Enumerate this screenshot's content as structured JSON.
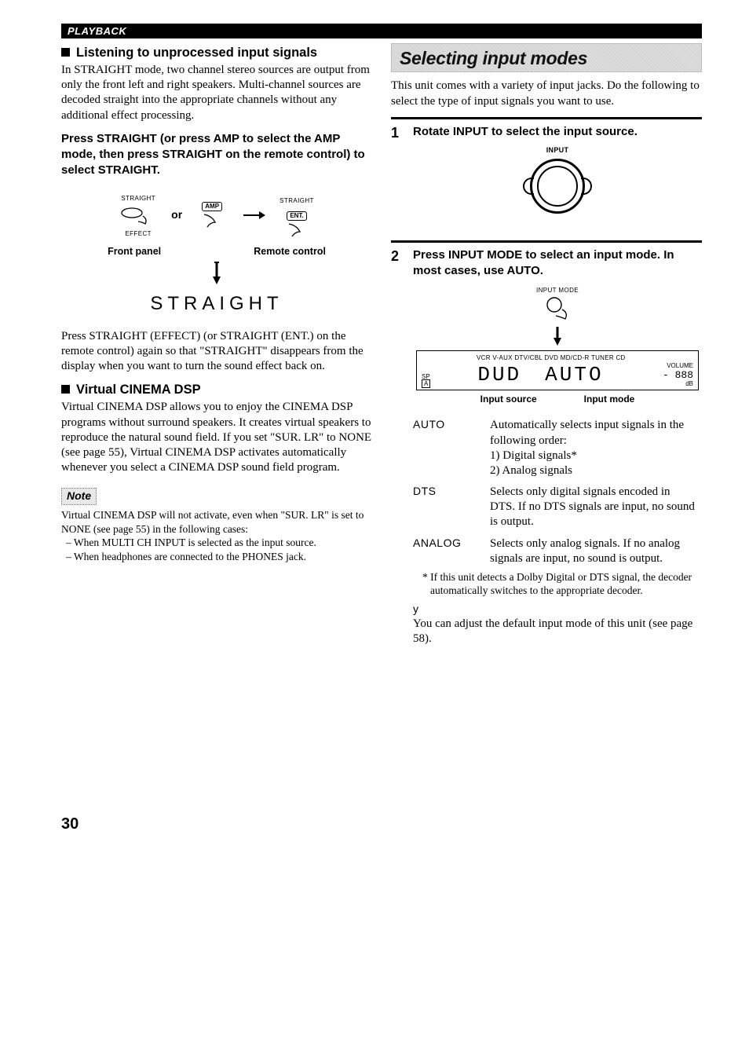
{
  "header": {
    "strip": "PLAYBACK"
  },
  "left": {
    "h1": "Listening to unprocessed input signals",
    "p1": "In STRAIGHT mode, two channel stereo sources are output from only the front left and right speakers. Multi-channel sources are decoded straight into the appropriate channels without any additional effect processing.",
    "instr": "Press STRAIGHT (or press AMP to select the AMP mode, then press STRAIGHT on the remote control) to select STRAIGHT.",
    "diag": {
      "straight_btn": "STRAIGHT",
      "effect_btn": "EFFECT",
      "or": "or",
      "amp_btn": "AMP",
      "ent_btn": "STRAIGHT",
      "ent_sub": "ENT.",
      "front_panel": "Front panel",
      "remote": "Remote control"
    },
    "straight_display": "STRAIGHT",
    "p2": "Press STRAIGHT (EFFECT) (or STRAIGHT (ENT.) on the remote control) again so that \"STRAIGHT\" disappears from the display when you want to turn the sound effect back on.",
    "h2": "Virtual CINEMA DSP",
    "p3": "Virtual CINEMA DSP allows you to enjoy the CINEMA DSP programs without surround speakers. It creates virtual speakers to reproduce the natural sound field. If you set \"SUR. LR\" to NONE (see page 55), Virtual CINEMA DSP activates automatically whenever you select a CINEMA DSP sound field program.",
    "note_label": "Note",
    "note1": "Virtual CINEMA DSP will not activate, even when \"SUR. LR\" is set to NONE (see page 55) in the following cases:",
    "note_b1": "– When MULTI CH INPUT is selected as the input source.",
    "note_b2": "– When headphones are connected to the PHONES jack."
  },
  "right": {
    "banner": "Selecting input modes",
    "intro": "This unit comes with a variety of input jacks. Do the following to select the type of input signals you want to use.",
    "step1": "Rotate INPUT to select the input source.",
    "input_label": "INPUT",
    "step2": "Press INPUT MODE to select an input mode. In most cases, use AUTO.",
    "inputmode_label": "INPUT MODE",
    "display": {
      "sources": "VCR    V-AUX    DTV/CBL    DVD    MD/CD-R    TUNER    CD",
      "sp": "SP",
      "a": "A",
      "dvd": "DUD",
      "auto": "AUTO",
      "volume": "VOLUME",
      "db": "dB"
    },
    "disp_lbl_src": "Input source",
    "disp_lbl_mode": "Input mode",
    "modes": {
      "auto_lbl": "AUTO",
      "auto_txt": "Automatically selects input signals in the following order:",
      "auto_1": "1) Digital signals*",
      "auto_2": "2) Analog signals",
      "dts_lbl": "DTS",
      "dts_txt": "Selects only digital signals encoded in DTS. If no DTS signals are input, no sound is output.",
      "analog_lbl": "ANALOG",
      "analog_txt": "Selects only analog signals. If no analog signals are input, no sound is output."
    },
    "asterisk": "*  If this unit detects a Dolby Digital or DTS signal, the decoder automatically switches to the appropriate decoder.",
    "tip_sym": "y",
    "tip": "You can adjust the default input mode of this unit (see page 58)."
  },
  "page_number": "30"
}
